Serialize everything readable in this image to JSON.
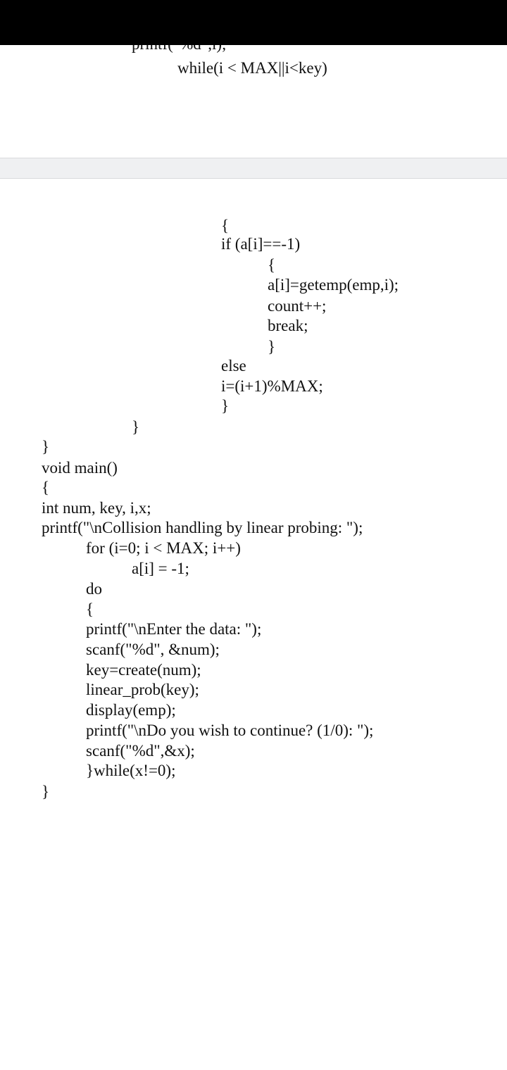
{
  "page_top": {
    "lines": [
      "printf(\"%d\",i);",
      "while(i < MAX||i<key)"
    ]
  },
  "page_bottom": {
    "lines": [
      "{",
      "if (a[i]==-1)",
      "{",
      "a[i]=getemp(emp,i);",
      "count++;",
      "break;",
      "}",
      "else",
      "i=(i+1)%MAX;",
      "}",
      "}",
      "}",
      "void main()",
      "{",
      "int num, key, i,x;",
      "printf(\"\\nCollision handling by linear probing: \");",
      "for (i=0; i < MAX; i++)",
      "a[i] = -1;",
      "do",
      "{",
      "printf(\"\\nEnter the data: \");",
      "scanf(\"%d\", &num);",
      "key=create(num);",
      "linear_prob(key);",
      "display(emp);",
      "printf(\"\\nDo you wish to continue? (1/0): \");",
      "scanf(\"%d\",&x);",
      "}while(x!=0);",
      "}"
    ]
  }
}
